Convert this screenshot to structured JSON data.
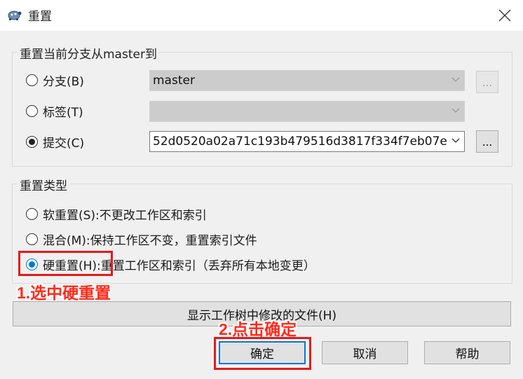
{
  "window": {
    "title": "重置",
    "app_icon": "tortoise-icon",
    "close_icon": "close-icon"
  },
  "reset_target": {
    "legend": "重置当前分支从master到",
    "branch_label": "分支(B)",
    "branch_value": "master",
    "tag_label": "标签(T)",
    "tag_value": "",
    "commit_label": "提交(C)",
    "commit_value": "52d0520a02a71c193b479516d3817f334f7eb07e",
    "browse_label": "...",
    "selected": "commit"
  },
  "reset_type": {
    "legend": "重置类型",
    "soft_label": "软重置(S):",
    "soft_desc": "不更改工作区和索引",
    "mixed_label": "混合(M):",
    "mixed_desc": "保持工作区不变，重置索引文件",
    "hard_label": "硬重置(H):",
    "hard_desc": "重置工作区和索引（丢弃所有本地变更）",
    "selected": "hard"
  },
  "buttons": {
    "show_modified": "显示工作树中修改的文件(H)",
    "ok": "确定",
    "cancel": "取消",
    "help": "帮助"
  },
  "annotations": {
    "step1": "1.选中硬重置",
    "step2": "2.点击确定",
    "color": "#e31b1b"
  }
}
